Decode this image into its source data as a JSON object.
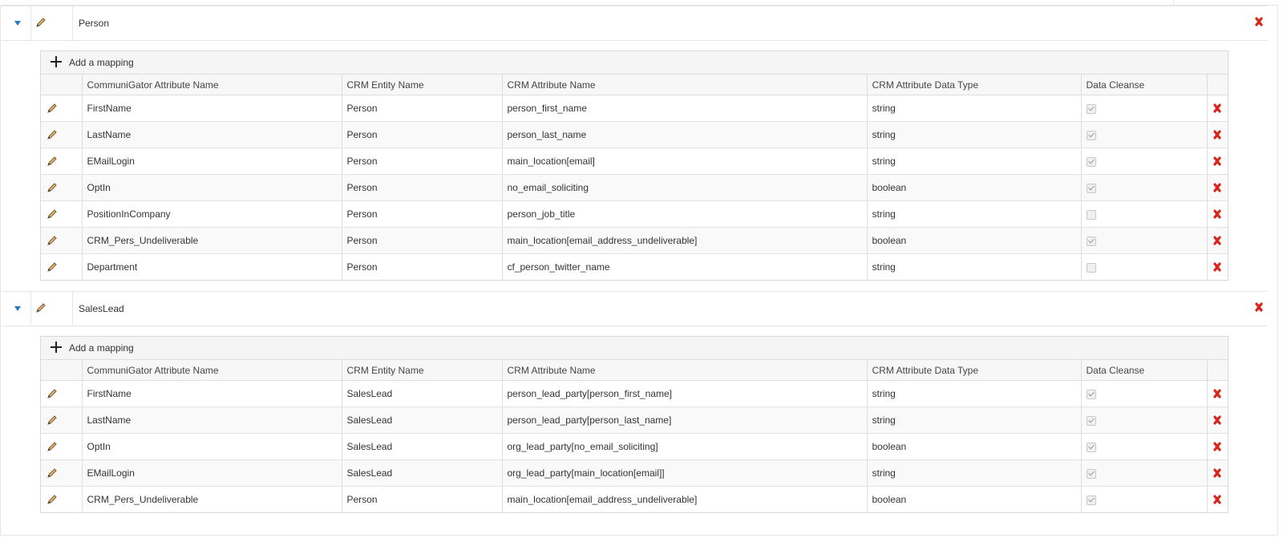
{
  "add_mapping_label": "Add a mapping",
  "columns": [
    "CommuniGator Attribute Name",
    "CRM Entity Name",
    "CRM Attribute Name",
    "CRM Attribute Data Type",
    "Data Cleanse"
  ],
  "icons": {
    "expand": "caret-down-icon",
    "edit": "pencil-icon",
    "delete": "delete-x-icon",
    "add": "plus-icon"
  },
  "colors": {
    "delete": "#d9261c",
    "caret": "#2a78c2"
  },
  "entities": [
    {
      "name": "Person",
      "rows": [
        {
          "attr": "FirstName",
          "entity": "Person",
          "crm_attr": "person_first_name",
          "type": "string",
          "cleanse": true
        },
        {
          "attr": "LastName",
          "entity": "Person",
          "crm_attr": "person_last_name",
          "type": "string",
          "cleanse": true
        },
        {
          "attr": "EMailLogin",
          "entity": "Person",
          "crm_attr": "main_location[email]",
          "type": "string",
          "cleanse": true
        },
        {
          "attr": "OptIn",
          "entity": "Person",
          "crm_attr": "no_email_soliciting",
          "type": "boolean",
          "cleanse": true
        },
        {
          "attr": "PositionInCompany",
          "entity": "Person",
          "crm_attr": "person_job_title",
          "type": "string",
          "cleanse": false
        },
        {
          "attr": "CRM_Pers_Undeliverable",
          "entity": "Person",
          "crm_attr": "main_location[email_address_undeliverable]",
          "type": "boolean",
          "cleanse": true
        },
        {
          "attr": "Department",
          "entity": "Person",
          "crm_attr": "cf_person_twitter_name",
          "type": "string",
          "cleanse": false
        }
      ]
    },
    {
      "name": "SalesLead",
      "rows": [
        {
          "attr": "FirstName",
          "entity": "SalesLead",
          "crm_attr": "person_lead_party[person_first_name]",
          "type": "string",
          "cleanse": true
        },
        {
          "attr": "LastName",
          "entity": "SalesLead",
          "crm_attr": "person_lead_party[person_last_name]",
          "type": "string",
          "cleanse": true
        },
        {
          "attr": "OptIn",
          "entity": "SalesLead",
          "crm_attr": "org_lead_party[no_email_soliciting]",
          "type": "boolean",
          "cleanse": true
        },
        {
          "attr": "EMailLogin",
          "entity": "SalesLead",
          "crm_attr": "org_lead_party[main_location[email]]",
          "type": "string",
          "cleanse": true
        },
        {
          "attr": "CRM_Pers_Undeliverable",
          "entity": "Person",
          "crm_attr": "main_location[email_address_undeliverable]",
          "type": "boolean",
          "cleanse": true
        }
      ]
    }
  ]
}
